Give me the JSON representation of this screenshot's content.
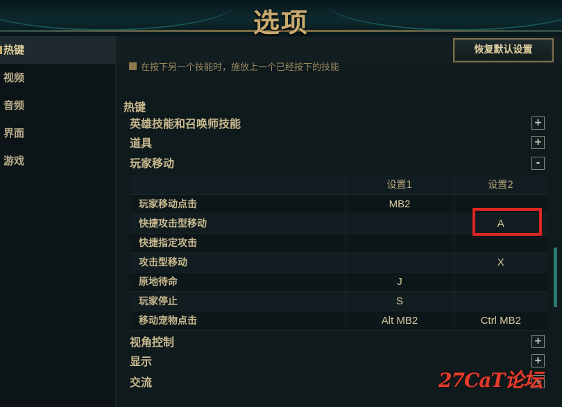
{
  "window": {
    "title": "选项"
  },
  "sidebar": {
    "items": [
      {
        "label": "热键"
      },
      {
        "label": "视频"
      },
      {
        "label": "音频"
      },
      {
        "label": "界面"
      },
      {
        "label": "游戏"
      }
    ]
  },
  "toolbar": {
    "reset_label": "恢复默认设置"
  },
  "content": {
    "partial_line": "在按下另一个技能时，施放上一个已经按下的技能",
    "section_title": "热键",
    "categories": [
      {
        "label": "英雄技能和召唤师技能",
        "toggle": "+"
      },
      {
        "label": "道具",
        "toggle": "+"
      },
      {
        "label": "玩家移动",
        "toggle": "-"
      },
      {
        "label": "视角控制",
        "toggle": "+"
      },
      {
        "label": "显示",
        "toggle": "+"
      },
      {
        "label": "交流",
        "toggle": "+"
      }
    ],
    "table": {
      "col1": "设置1",
      "col2": "设置2",
      "rows": [
        {
          "name": "玩家移动点击",
          "k1": "MB2",
          "k2": ""
        },
        {
          "name": "快捷攻击型移动",
          "k1": "",
          "k2": "A"
        },
        {
          "name": "快捷指定攻击",
          "k1": "",
          "k2": ""
        },
        {
          "name": "攻击型移动",
          "k1": "",
          "k2": "X"
        },
        {
          "name": "原地待命",
          "k1": "J",
          "k2": ""
        },
        {
          "name": "玩家停止",
          "k1": "S",
          "k2": ""
        },
        {
          "name": "移动宠物点击",
          "k1": "Alt MB2",
          "k2": "Ctrl MB2"
        }
      ]
    }
  },
  "watermark": "27CaT论坛",
  "colors": {
    "accent_gold": "#c8aa6e",
    "highlight_red": "#e02424",
    "scroll_teal": "#2a7a70"
  }
}
